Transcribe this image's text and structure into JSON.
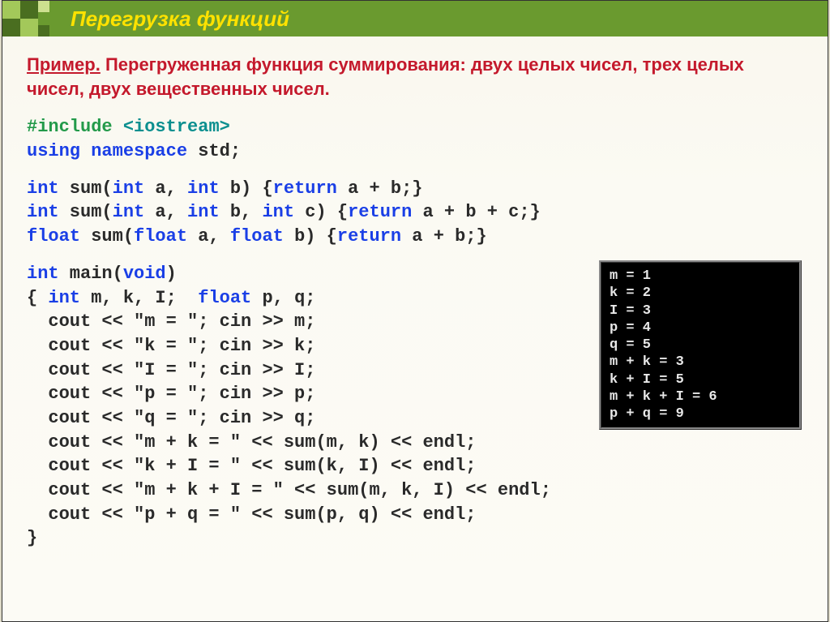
{
  "header": {
    "title": "Перегрузка функций"
  },
  "example": {
    "label": "Пример.",
    "text_rest": " Перегруженная функция суммирования: двух целых чисел, трех целых чисел, двух вещественных чисел."
  },
  "code": {
    "include_hash": "#include ",
    "include_lib": "<iostream>",
    "using_kw": "using ",
    "namespace_kw": "namespace ",
    "std_text": "std;",
    "fn1_a": "int",
    "fn1_b": " sum(",
    "fn1_c": "int",
    "fn1_d": " a, ",
    "fn1_e": "int",
    "fn1_f": " b) {",
    "fn1_g": "return",
    "fn1_h": " a + b;}",
    "fn2_a": "int",
    "fn2_b": " sum(",
    "fn2_c": "int",
    "fn2_d": " a, ",
    "fn2_e": "int",
    "fn2_f": " b, ",
    "fn2_g": "int",
    "fn2_h": " c) {",
    "fn2_i": "return",
    "fn2_j": " a + b + c;}",
    "fn3_a": "float",
    "fn3_b": " sum(",
    "fn3_c": "float",
    "fn3_d": " a, ",
    "fn3_e": "float",
    "fn3_f": " b) {",
    "fn3_g": "return",
    "fn3_h": " a + b;}",
    "main_a": "int",
    "main_b": " main(",
    "main_c": "void",
    "main_d": ")",
    "l1_a": "{ ",
    "l1_b": "int",
    "l1_c": " m, k, I;  ",
    "l1_d": "float",
    "l1_e": " p, q;",
    "l2": "  cout << \"m = \"; cin >> m;",
    "l3": "  cout << \"k = \"; cin >> k;",
    "l4": "  cout << \"I = \"; cin >> I;",
    "l5": "  cout << \"p = \"; cin >> p;",
    "l6": "  cout << \"q = \"; cin >> q;",
    "l7": "  cout << \"m + k = \" << sum(m, k) << endl;",
    "l8": "  cout << \"k + I = \" << sum(k, I) << endl;",
    "l9": "  cout << \"m + k + I = \" << sum(m, k, I) << endl;",
    "l10": "  cout << \"p + q = \" << sum(p, q) << endl;",
    "l11": "}"
  },
  "console": {
    "line1": "m = 1",
    "line2": "k = 2",
    "line3": "I = 3",
    "line4": "p = 4",
    "line5": "q = 5",
    "line6": "m + k = 3",
    "line7": "k + I = 5",
    "line8": "m + k + I = 6",
    "line9": "p + q = 9"
  }
}
